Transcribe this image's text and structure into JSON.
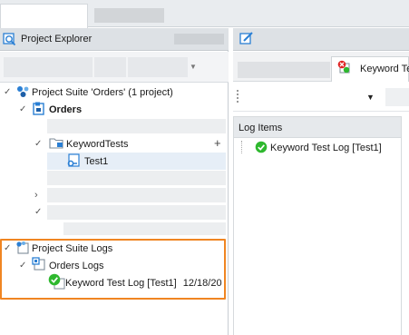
{
  "left_panel": {
    "title": "Project Explorer",
    "tree": {
      "suite_label": "Project Suite 'Orders' (1 project)",
      "project_label": "Orders",
      "folder_label": "KeywordTests",
      "plus_sign": "+",
      "test_label": "Test1",
      "logs_label": "Project Suite Logs",
      "orders_logs_label": "Orders Logs",
      "log_entry_label": "Keyword Test Log [Test1]",
      "log_entry_date": "12/18/20"
    }
  },
  "right_panel": {
    "tab_label": "Keyword Te",
    "log_items_header": "Log Items",
    "log_item_label": "Keyword Test Log [Test1]"
  },
  "colors": {
    "highlight_border": "#f08522",
    "success_green": "#2eb82e",
    "icon_blue": "#2a7fd4"
  },
  "icons": [
    "project-explorer-icon",
    "project-suite-icon",
    "project-icon",
    "folder-icon",
    "keyword-test-icon",
    "logs-icon",
    "log-icon",
    "success-check-icon",
    "edit-icon",
    "error-badge-icon"
  ]
}
